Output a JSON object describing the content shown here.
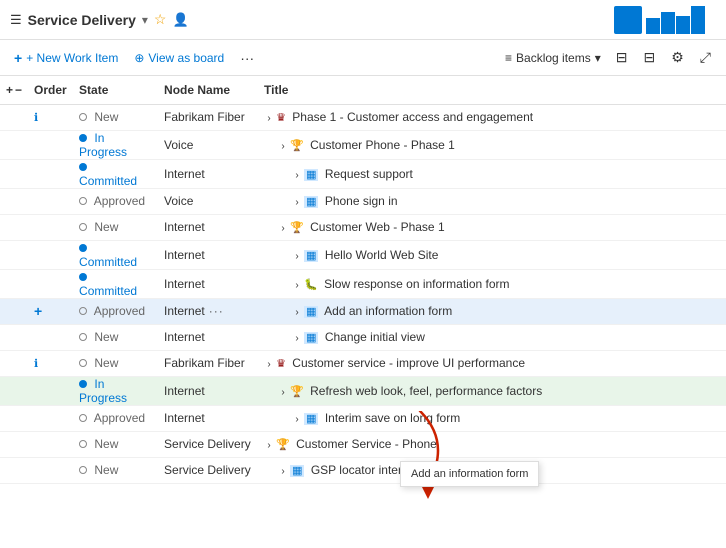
{
  "header": {
    "title": "Service Delivery",
    "chevron": "▾",
    "star_icon": "☆",
    "person_icon": "👤"
  },
  "toolbar": {
    "new_work_item": "+ New Work Item",
    "view_as_board": "View as board",
    "ellipsis": "···",
    "backlog_items": "Backlog items",
    "chevron": "▾"
  },
  "table": {
    "columns": [
      "Order",
      "State",
      "Node Name",
      "Title"
    ],
    "rows": [
      {
        "id": "r1",
        "order": "",
        "order_icon": "ℹ",
        "state_type": "new",
        "state": "New",
        "node": "Fabrikam Fiber",
        "indent": 1,
        "item_icon": "epic",
        "expand": "›",
        "title": "Phase 1 - Customer access and engagement",
        "highlighted": false
      },
      {
        "id": "r2",
        "order": "",
        "order_icon": "",
        "state_type": "inprogress",
        "state": "In Progress",
        "node": "Voice",
        "indent": 2,
        "item_icon": "story",
        "expand": "›",
        "title": "Customer Phone - Phase 1",
        "highlighted": false
      },
      {
        "id": "r3",
        "order": "",
        "order_icon": "",
        "state_type": "committed",
        "state": "Committed",
        "node": "Internet",
        "indent": 3,
        "item_icon": "feature",
        "expand": "›",
        "title": "Request support",
        "highlighted": false
      },
      {
        "id": "r4",
        "order": "",
        "order_icon": "",
        "state_type": "approved",
        "state": "Approved",
        "node": "Voice",
        "indent": 3,
        "item_icon": "feature",
        "expand": "›",
        "title": "Phone sign in",
        "highlighted": false
      },
      {
        "id": "r5",
        "order": "",
        "order_icon": "",
        "state_type": "new",
        "state": "New",
        "node": "Internet",
        "indent": 2,
        "item_icon": "story",
        "expand": "›",
        "title": "Customer Web - Phase 1",
        "highlighted": false
      },
      {
        "id": "r6",
        "order": "",
        "order_icon": "",
        "state_type": "committed",
        "state": "Committed",
        "node": "Internet",
        "indent": 3,
        "item_icon": "feature",
        "expand": "›",
        "title": "Hello World Web Site",
        "highlighted": false
      },
      {
        "id": "r7",
        "order": "",
        "order_icon": "",
        "state_type": "committed",
        "state": "Committed",
        "node": "Internet",
        "indent": 3,
        "item_icon": "bug",
        "expand": "›",
        "title": "Slow response on information form",
        "highlighted": false
      },
      {
        "id": "r8",
        "order": "+",
        "order_icon": "",
        "state_type": "approved",
        "state": "Approved",
        "node": "Internet",
        "indent": 3,
        "item_icon": "feature",
        "expand": "›",
        "title": "Add an information form",
        "highlighted": false,
        "ellipsis": "···",
        "active": true
      },
      {
        "id": "r9",
        "order": "",
        "order_icon": "",
        "state_type": "new",
        "state": "New",
        "node": "Internet",
        "indent": 3,
        "item_icon": "feature",
        "expand": "›",
        "title": "Change initial view",
        "highlighted": false
      },
      {
        "id": "r10",
        "order": "",
        "order_icon": "ℹ",
        "state_type": "new",
        "state": "New",
        "node": "Fabrikam Fiber",
        "indent": 1,
        "item_icon": "epic",
        "expand": "›",
        "title": "Customer service - improve UI performance",
        "highlighted": false
      },
      {
        "id": "r11",
        "order": "",
        "order_icon": "",
        "state_type": "inprogress",
        "state": "In Progress",
        "node": "Internet",
        "indent": 2,
        "item_icon": "story",
        "expand": "›",
        "title": "Refresh web look, feel, performance factors",
        "highlighted": true
      },
      {
        "id": "r12",
        "order": "",
        "order_icon": "",
        "state_type": "approved",
        "state": "Approved",
        "node": "Internet",
        "indent": 3,
        "item_icon": "feature",
        "expand": "›",
        "title": "Interim save on long form",
        "highlighted": false
      },
      {
        "id": "r13",
        "order": "",
        "order_icon": "",
        "state_type": "new",
        "state": "New",
        "node": "Service Delivery",
        "indent": 1,
        "item_icon": "story",
        "expand": "›",
        "title": "Customer Service - Phone",
        "highlighted": false
      },
      {
        "id": "r14",
        "order": "",
        "order_icon": "",
        "state_type": "new",
        "state": "New",
        "node": "Service Delivery",
        "indent": 2,
        "item_icon": "feature",
        "expand": "›",
        "title": "GSP locator interface",
        "highlighted": false
      }
    ]
  },
  "tooltip": {
    "text": "Add an information form"
  },
  "icons": {
    "grid": "☰",
    "plus": "+",
    "circle_plus": "⊕",
    "list": "≡",
    "filter": "⊟",
    "settings": "⚙",
    "expand": "⤢",
    "chevron_down": "▾",
    "ellipsis": "···",
    "info": "ⓘ"
  }
}
